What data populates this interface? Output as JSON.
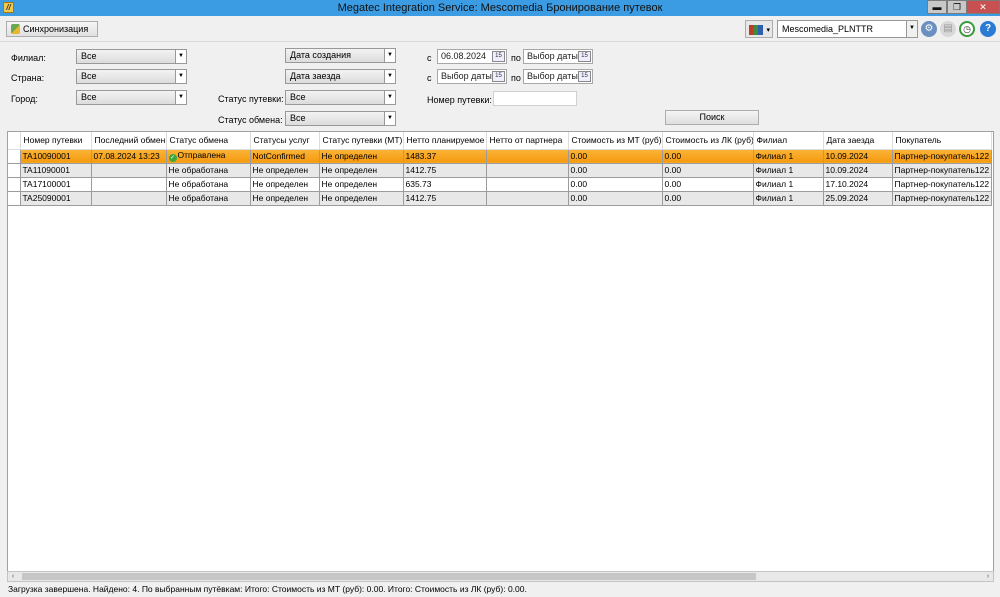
{
  "window": {
    "title": "Megatec Integration Service: Mescomedia Бронирование путевок",
    "minimize": "▬",
    "restore": "❐",
    "close": "✕"
  },
  "toolbar": {
    "sync_label": "Синхронизация",
    "db_name": "Mescomedia_PLNTTR"
  },
  "filters": {
    "branch_label": "Филиал:",
    "branch_value": "Все",
    "country_label": "Страна:",
    "country_value": "Все",
    "city_label": "Город:",
    "city_value": "Все",
    "date_type_1": "Дата создания",
    "date_type_2": "Дата заезда",
    "trip_status_label": "Статус путевки:",
    "trip_status_value": "Все",
    "exchange_status_label": "Статус обмена:",
    "exchange_status_value": "Все",
    "from_label": "с",
    "to_label": "по",
    "date1_from": "06.08.2024",
    "date1_to": "Выбор даты",
    "date2_from": "Выбор даты",
    "date2_to": "Выбор даты",
    "calendar_glyph": "15",
    "trip_number_label": "Номер путевки:",
    "search_label": "Поиск"
  },
  "grid": {
    "columns": [
      "Номер путевки",
      "Последний обмен",
      "Статус обмена",
      "Статусы услуг",
      "Статус путевки (МТ)",
      "Нетто планируемое",
      "Нетто от партнера",
      "Стоимость из МТ (руб)",
      "Стоимость из ЛК (руб)",
      "Филиал",
      "Дата заезда",
      "Покупатель"
    ],
    "rows": [
      [
        "TA10090001",
        "07.08.2024 13:23",
        "Отправлена",
        "NotConfirmed",
        "Не определен",
        "1483.37",
        "",
        "0.00",
        "0.00",
        "Филиал 1",
        "10.09.2024",
        "Партнер-покупатель122"
      ],
      [
        "TA11090001",
        "",
        "Не обработана",
        "Не определен",
        "Не определен",
        "1412.75",
        "",
        "0.00",
        "0.00",
        "Филиал 1",
        "10.09.2024",
        "Партнер-покупатель122"
      ],
      [
        "TA17100001",
        "",
        "Не обработана",
        "Не определен",
        "Не определен",
        "635.73",
        "",
        "0.00",
        "0.00",
        "Филиал 1",
        "17.10.2024",
        "Партнер-покупатель122"
      ],
      [
        "TA25090001",
        "",
        "Не обработана",
        "Не определен",
        "Не определен",
        "1412.75",
        "",
        "0.00",
        "0.00",
        "Филиал 1",
        "25.09.2024",
        "Партнер-покупатель122"
      ]
    ]
  },
  "status_bar": {
    "text": "Загрузка завершена. Найдено: 4. По выбранным путёвкам: Итого: Стоимость из МТ (руб): 0.00. Итого: Стоимость из ЛК (руб): 0.00."
  }
}
